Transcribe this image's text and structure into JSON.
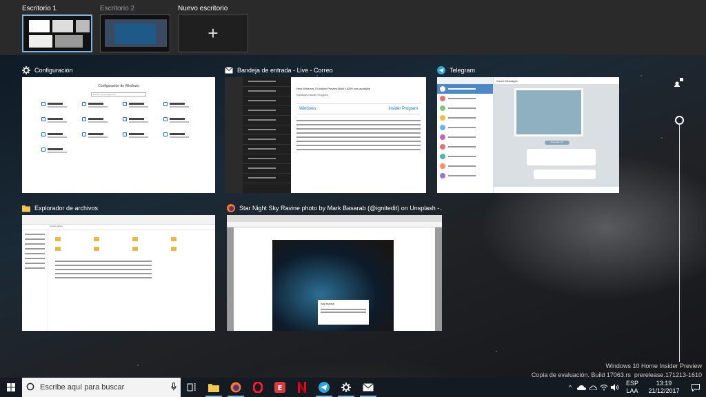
{
  "desktops": [
    {
      "label": "Escritorio 1",
      "active": true
    },
    {
      "label": "Escritorio 2",
      "active": false
    }
  ],
  "new_desktop_label": "Nuevo escritorio",
  "windows": {
    "settings": {
      "title": "Configuración",
      "heading": "Configuración de Windows",
      "search_placeholder": "Buscar una configuración"
    },
    "mail": {
      "title": "Bandeja de entrada - Live - Correo",
      "subject": "New Windows 10 Insider Preview Build 16299 now available",
      "sender": "Windows Insider Program",
      "banner_left": "Windows",
      "banner_right": "Insider Program"
    },
    "telegram": {
      "title": "Telegram",
      "chat_header": "Saved Messages",
      "date_chip": "December 20"
    },
    "explorer": {
      "title": "Explorador de archivos",
      "address": "Acceso rápido"
    },
    "firefox": {
      "title": "Star Night Sky Ravine photo by Mark Basarab (@ignitedit) on Unsplash -...",
      "card_title": "Say thanks"
    }
  },
  "watermark": {
    "line1": "Windows 10 Home Insider Preview",
    "line2": "Copia de evaluación. Build 17063.rs_prerelease.171213-1610"
  },
  "taskbar": {
    "search_placeholder": "Escribe aquí para buscar",
    "language": "ESP",
    "layout": "LAA",
    "time": "13:19",
    "date": "21/12/2017",
    "accent": "#7ab3e6"
  }
}
